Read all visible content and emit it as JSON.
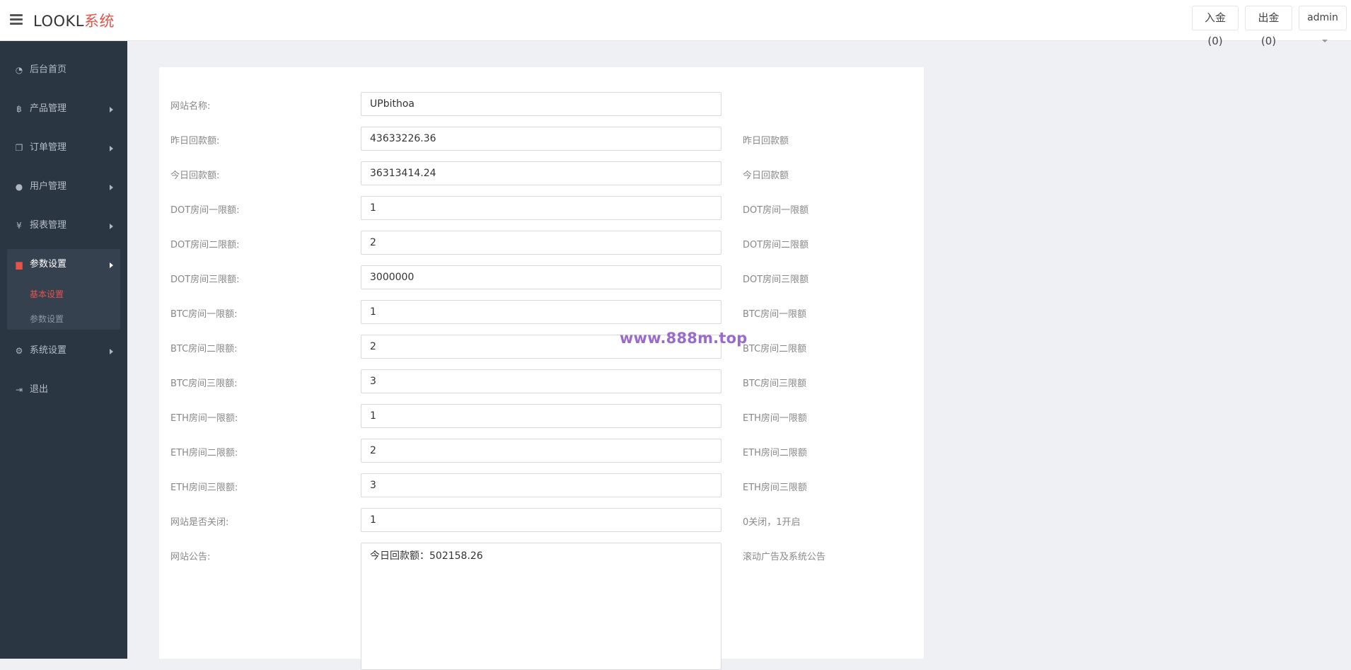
{
  "header": {
    "logo_main": "LOOKL",
    "logo_accent": "系统",
    "deposit_label": "入金(0)",
    "withdraw_label": "出金(0)",
    "user_label": "admin"
  },
  "sidebar": {
    "items": [
      {
        "label": "后台首页",
        "icon": "dashboard-icon"
      },
      {
        "label": "产品管理",
        "icon": "bitcoin-icon"
      },
      {
        "label": "订单管理",
        "icon": "copy-icon"
      },
      {
        "label": "用户管理",
        "icon": "user-icon"
      },
      {
        "label": "报表管理",
        "icon": "yen-icon"
      },
      {
        "label": "参数设置",
        "icon": "files-icon"
      },
      {
        "label": "系统设置",
        "icon": "gears-icon"
      },
      {
        "label": "退出",
        "icon": "sign-out-icon"
      }
    ],
    "sub_items": [
      {
        "label": "基本设置"
      },
      {
        "label": "参数设置"
      }
    ],
    "accent_color": "#e5534b"
  },
  "form": {
    "rows": [
      {
        "label": "网站名称:",
        "value": "UPbithoa",
        "hint": ""
      },
      {
        "label": "昨日回款额:",
        "value": "43633226.36",
        "hint": "昨日回款额"
      },
      {
        "label": "今日回款额:",
        "value": "36313414.24",
        "hint": "今日回款额"
      },
      {
        "label": "DOT房间一限额:",
        "value": "1",
        "hint": "DOT房间一限额"
      },
      {
        "label": "DOT房间二限额:",
        "value": "2",
        "hint": "DOT房间二限额"
      },
      {
        "label": "DOT房间三限额:",
        "value": "3000000",
        "hint": "DOT房间三限额"
      },
      {
        "label": "BTC房间一限额:",
        "value": "1",
        "hint": "BTC房间一限额"
      },
      {
        "label": "BTC房间二限额:",
        "value": "2",
        "hint": "BTC房间二限额"
      },
      {
        "label": "BTC房间三限额:",
        "value": "3",
        "hint": "BTC房间三限额"
      },
      {
        "label": "ETH房间一限额:",
        "value": "1",
        "hint": "ETH房间一限额"
      },
      {
        "label": "ETH房间二限额:",
        "value": "2",
        "hint": "ETH房间二限额"
      },
      {
        "label": "ETH房间三限额:",
        "value": "3",
        "hint": "ETH房间三限额"
      },
      {
        "label": "网站是否关闭:",
        "value": "1",
        "hint": "0关闭，1开启"
      }
    ],
    "notice": {
      "label": "网站公告:",
      "value": "今日回款额：502158.26",
      "hint": "滚动广告及系统公告"
    }
  },
  "watermark": "www.888m.top"
}
